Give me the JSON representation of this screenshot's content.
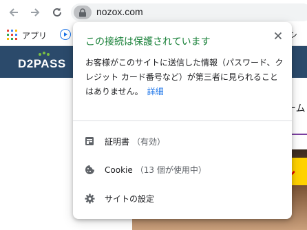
{
  "toolbar": {
    "url": "nozox.com"
  },
  "bookmarks": {
    "apps_label": "アプリ",
    "right_partial": "シ"
  },
  "page": {
    "logo": "D2PASS",
    "partial_text": "ーム",
    "promo_partial": "ル"
  },
  "popup": {
    "title": "この接続は保護されています",
    "body": "お客様がこのサイトに送信した情報（パスワード、クレジット カード番号など）が第三者に見られることはありません。",
    "details_link": "詳細",
    "rows": [
      {
        "label": "証明書",
        "sub": "（有効）"
      },
      {
        "label": "Cookie",
        "sub": "（13 個が使用中）"
      },
      {
        "label": "サイトの設定",
        "sub": ""
      }
    ]
  },
  "colors": {
    "secure_green": "#188038",
    "link_blue": "#1a73e8",
    "site_header": "#2b4a6b"
  },
  "icons": [
    "back-arrow-icon",
    "forward-arrow-icon",
    "reload-icon",
    "lock-icon",
    "apps-grid-icon",
    "play-icon",
    "close-icon",
    "certificate-icon",
    "cookie-icon",
    "settings-gear-icon"
  ]
}
